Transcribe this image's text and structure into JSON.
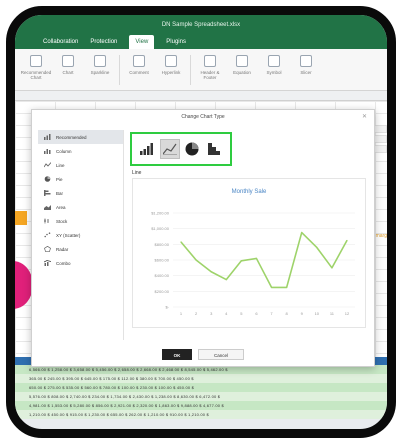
{
  "app": {
    "title": "DN Sample Spreadsheet.xlsx",
    "menu": [
      "Collaboration",
      "Protection",
      "View",
      "Plugins"
    ],
    "active_menu_index": 2,
    "accent": "#217346"
  },
  "ribbon": {
    "buttons": [
      "Recommended Chart",
      "Chart",
      "Sparkline",
      "Comment",
      "Hyperlink",
      "Header & Footer",
      "Equation",
      "Symbol",
      "Slicer"
    ]
  },
  "dialog": {
    "title": "Change Chart Type",
    "close_icon": "close-icon",
    "chart_types": [
      {
        "label": "Recommended",
        "icon": "recommended-chart-icon",
        "selected": true
      },
      {
        "label": "Column",
        "icon": "column-chart-icon",
        "selected": false
      },
      {
        "label": "Line",
        "icon": "line-chart-icon",
        "selected": false
      },
      {
        "label": "Pie",
        "icon": "pie-chart-icon",
        "selected": false
      },
      {
        "label": "Bar",
        "icon": "bar-chart-icon",
        "selected": false
      },
      {
        "label": "Area",
        "icon": "area-chart-icon",
        "selected": false
      },
      {
        "label": "Stock",
        "icon": "stock-chart-icon",
        "selected": false
      },
      {
        "label": "XY (Scatter)",
        "icon": "scatter-chart-icon",
        "selected": false
      },
      {
        "label": "Radar",
        "icon": "radar-chart-icon",
        "selected": false
      },
      {
        "label": "Combo",
        "icon": "combo-chart-icon",
        "selected": false
      }
    ],
    "subtypes": [
      {
        "icon": "column-chart-icon",
        "selected": false
      },
      {
        "icon": "line-chart-icon",
        "selected": true
      },
      {
        "icon": "pie-chart-icon",
        "selected": false
      },
      {
        "icon": "histogram-chart-icon",
        "selected": false
      }
    ],
    "subtype_highlight": "#2ecc40",
    "preview_label": "Line",
    "ok_label": "OK",
    "cancel_label": "Cancel"
  },
  "chart_data": {
    "type": "line",
    "title": "Monthly Sale",
    "x": [
      1,
      2,
      3,
      4,
      5,
      6,
      7,
      8,
      9,
      10,
      11,
      12
    ],
    "y_ticks": [
      "$1,200.00",
      "$1,000.00",
      "$800.00",
      "$600.00",
      "$400.00",
      "$200.00",
      "$-"
    ],
    "ylim": [
      0,
      1200
    ],
    "series": [
      {
        "values": [
          830,
          600,
          450,
          350,
          590,
          620,
          250,
          250,
          950,
          760,
          500,
          850
        ],
        "color": "#9ed36a"
      }
    ],
    "grid": true
  },
  "sheet": {
    "note_right": "Ave marg",
    "rows": [
      "6,566.00  $  1,258.00  $  3,658.00  $  5,456.00  $  2,658.00  $  2,668.00  $  2,468.00  $  8,545.00  $  5,462.00  $",
      "  365.00  $    245.00  $    395.00  $    645.00  $    175.00  $    112.00  $    380.00  $    700.00  $    450.00  $",
      "  650.00  $    275.00  $    535.00  $    560.00  $    780.00  $    100.00  $    230.00  $    100.00  $    450.00  $",
      "5,576.00  $    808.00  $  2,740.00  $    234.00  $  1,734.00  $  2,430.00  $  1,238.00  $  8,630.00  $  6,472.00  $",
      "4,981.00  $  1,553.00  $  5,280.00  $    856.00  $  2,921.00  $  2,320.00  $  1,863.00  $  9,888.00  $  4,677.00  $",
      "1,210.00  $    450.00  $    915.00  $  1,230.00  $    655.00  $    262.00  $  1,210.00  $    910.00  $  1,210.00  $"
    ]
  }
}
